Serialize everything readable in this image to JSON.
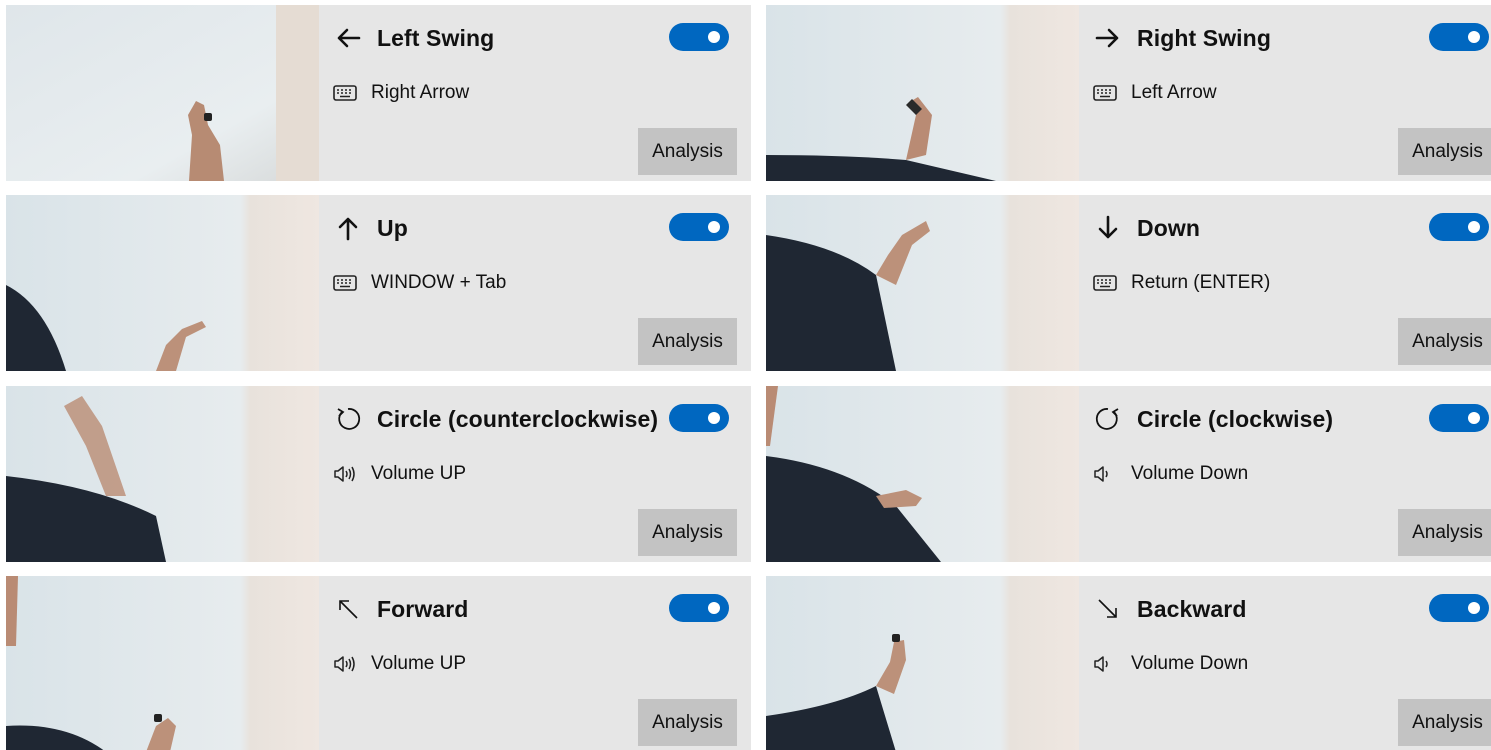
{
  "gestures": [
    {
      "title": "Left Swing",
      "icon": "arrow-left-icon",
      "action_icon": "keyboard-icon",
      "action": "Right Arrow",
      "enabled": true,
      "analysis_label": "Analysis"
    },
    {
      "title": "Right Swing",
      "icon": "arrow-right-icon",
      "action_icon": "keyboard-icon",
      "action": "Left Arrow",
      "enabled": true,
      "analysis_label": "Analysis"
    },
    {
      "title": "Up",
      "icon": "arrow-up-icon",
      "action_icon": "keyboard-icon",
      "action": "WINDOW + Tab",
      "enabled": true,
      "analysis_label": "Analysis"
    },
    {
      "title": "Down",
      "icon": "arrow-down-icon",
      "action_icon": "keyboard-icon",
      "action": "Return (ENTER)",
      "enabled": true,
      "analysis_label": "Analysis"
    },
    {
      "title": "Circle (counterclockwise)",
      "icon": "rotate-counterclockwise-icon",
      "action_icon": "volume-up-icon",
      "action": "Volume UP",
      "enabled": true,
      "analysis_label": "Analysis"
    },
    {
      "title": "Circle (clockwise)",
      "icon": "rotate-clockwise-icon",
      "action_icon": "volume-down-icon",
      "action": "Volume Down",
      "enabled": true,
      "analysis_label": "Analysis"
    },
    {
      "title": "Forward",
      "icon": "arrow-up-left-icon",
      "action_icon": "volume-up-icon",
      "action": "Volume UP",
      "enabled": true,
      "analysis_label": "Analysis"
    },
    {
      "title": "Backward",
      "icon": "arrow-down-right-icon",
      "action_icon": "volume-down-icon",
      "action": "Volume Down",
      "enabled": true,
      "analysis_label": "Analysis"
    }
  ],
  "colors": {
    "accent": "#0067c0",
    "panel": "#e6e6e6",
    "button": "#c3c3c3"
  }
}
